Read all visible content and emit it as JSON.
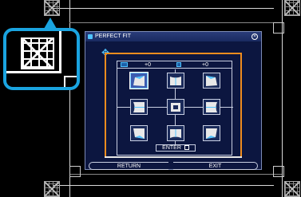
{
  "dialog": {
    "title": "PERFECT FIT",
    "title_icon": "perfect-fit-icon",
    "close_icon": "close-icon",
    "move_icon": "move-arrows-icon"
  },
  "adjust": {
    "horizontal_value": "+0",
    "vertical_value": "+0",
    "enter_label": "ENTER"
  },
  "nav": {
    "return_label": "RETURN",
    "exit_label": "EXIT"
  },
  "colors": {
    "callout": "#1aa4e0",
    "guide": "#f08c1e",
    "dialog_bg": "#0c1640"
  }
}
